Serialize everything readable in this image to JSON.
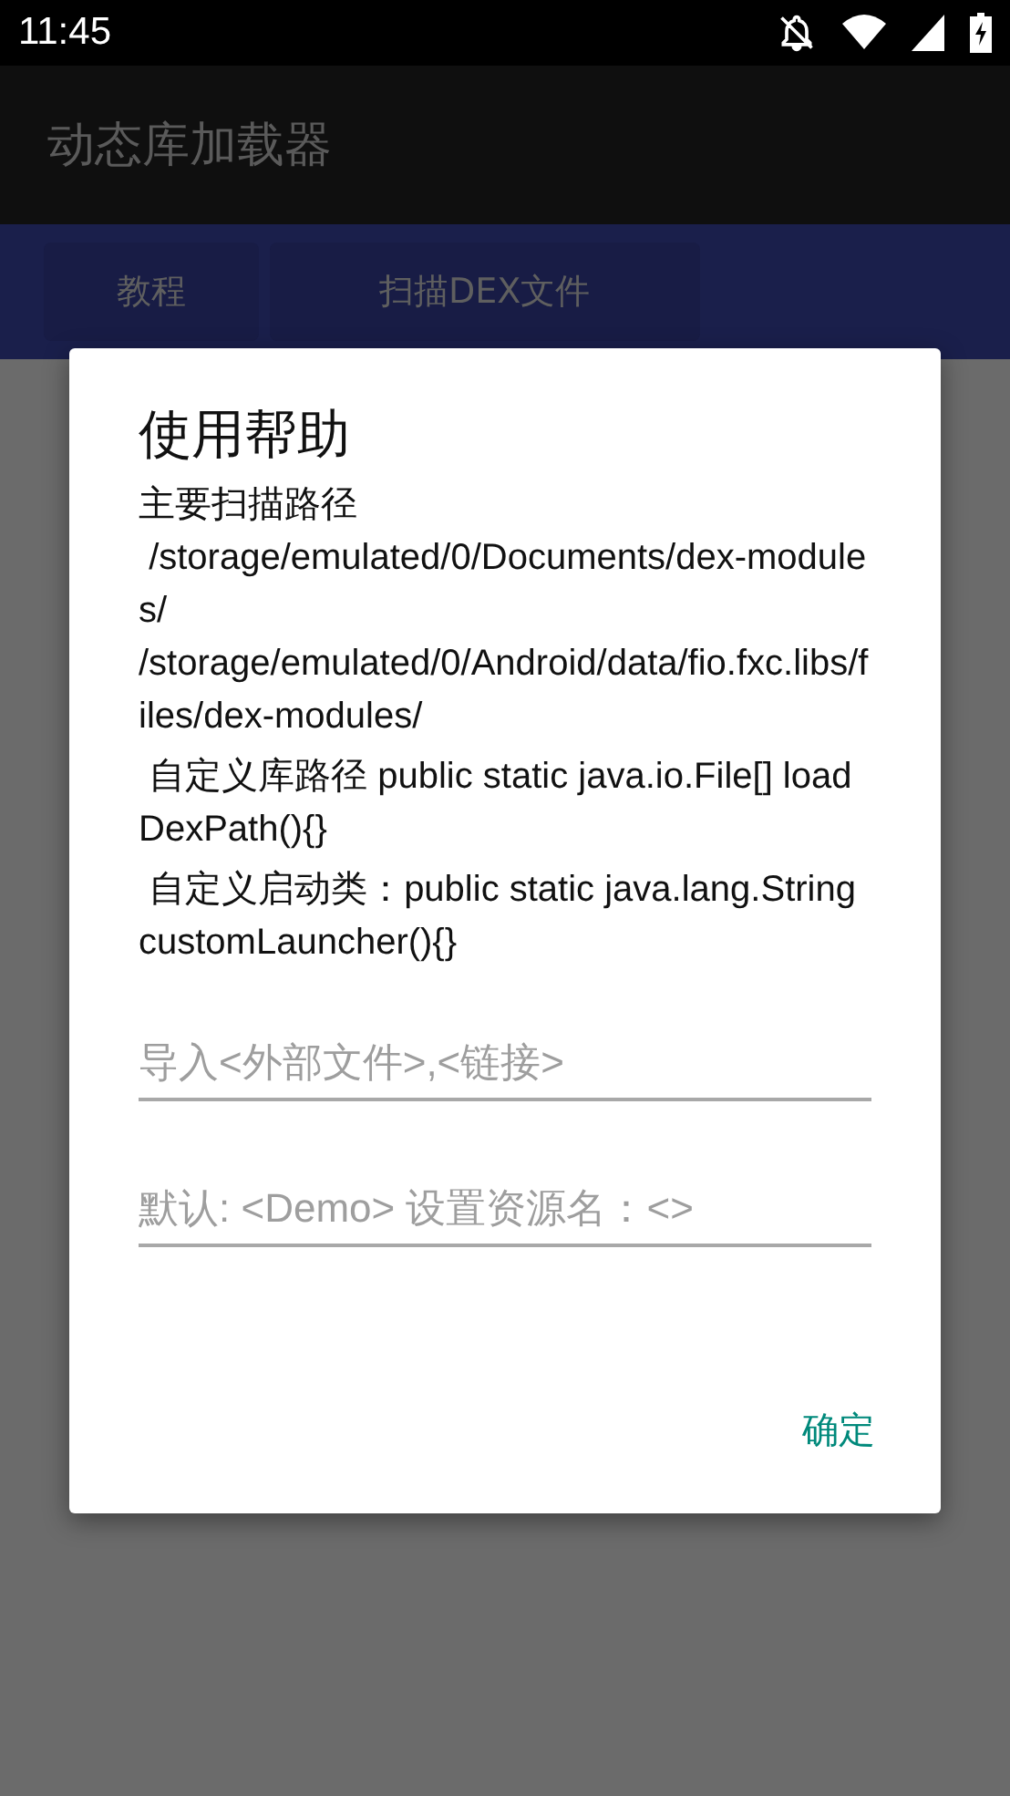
{
  "status_bar": {
    "time": "11:45"
  },
  "app_bar": {
    "title": "动态库加载器"
  },
  "tabs": [
    {
      "label": "教程"
    },
    {
      "label": "扫描DEX文件"
    }
  ],
  "dialog": {
    "title": "使用帮助",
    "lines": [
      "主要扫描路径",
      " /storage/emulated/0/Documents/dex-modules/",
      "/storage/emulated/0/Android/data/fio.fxc.libs/files/dex-modules/",
      " 自定义库路径 public static java.io.File[] loadDexPath(){}",
      " 自定义启动类：public static java.lang.String customLauncher(){}"
    ],
    "fields": [
      {
        "placeholder": "导入<外部文件>,<链接>"
      },
      {
        "placeholder": "默认: <Demo> 设置资源名：<>"
      }
    ],
    "button": "确定"
  }
}
